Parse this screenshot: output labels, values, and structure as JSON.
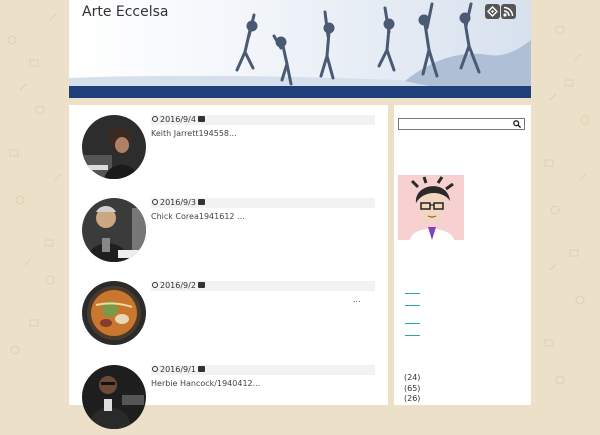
{
  "site": {
    "title": "Arte Eccelsa"
  },
  "header": {
    "icons": [
      "feedly-icon",
      "rss-icon"
    ]
  },
  "posts": [
    {
      "date": "2016/9/4",
      "excerpt": "Keith Jarrett194558..."
    },
    {
      "date": "2016/9/3",
      "excerpt": "Chick Corea1941612 ..."
    },
    {
      "date": "2016/9/2",
      "excerpt": "..."
    },
    {
      "date": "2016/9/1",
      "excerpt": "Herbie Hancock/1940412..."
    }
  ],
  "sidebar": {
    "search": {
      "placeholder": ""
    },
    "counts": [
      "(24)",
      "(65)",
      "(26)"
    ]
  },
  "colors": {
    "accent_bar": "#1f3f7a",
    "link": "#2aa7a0",
    "page_bg": "#ece0c8"
  }
}
